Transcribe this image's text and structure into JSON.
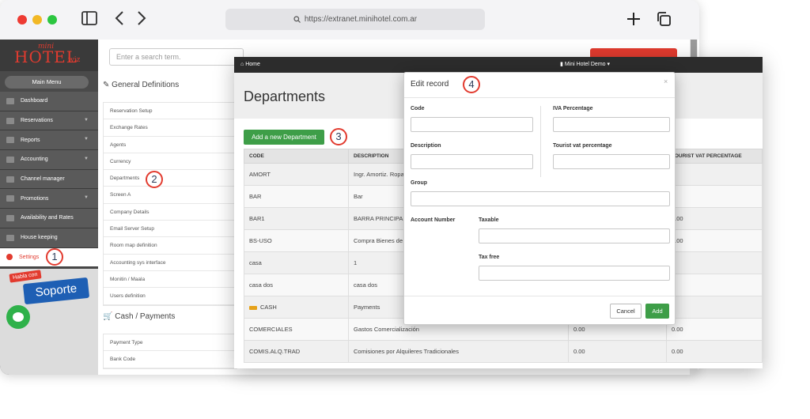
{
  "browser": {
    "url": "https://extranet.minihotel.com.ar",
    "sidebar_toggle_icon": "sidebar-icon",
    "back_icon": "chevron-left-icon",
    "forward_icon": "chevron-right-icon",
    "new_tab_icon": "plus-icon",
    "tabs_icon": "tabs-icon"
  },
  "logo": {
    "mini": "mini",
    "hotel": "HOTEL",
    "wiz": "wiz"
  },
  "sidebar": {
    "main_menu": "Main Menu",
    "items": [
      {
        "label": "Dashboard",
        "icon": "dashboard-icon",
        "has_submenu": false
      },
      {
        "label": "Reservations",
        "icon": "calendar-icon",
        "has_submenu": true
      },
      {
        "label": "Reports",
        "icon": "chart-icon",
        "has_submenu": true
      },
      {
        "label": "Accounting",
        "icon": "money-icon",
        "has_submenu": true
      },
      {
        "label": "Channel manager",
        "icon": "channel-icon",
        "has_submenu": false
      },
      {
        "label": "Promotions",
        "icon": "sitemap-icon",
        "has_submenu": true
      },
      {
        "label": "Availability and Rates",
        "icon": "pencil-icon",
        "has_submenu": false
      },
      {
        "label": "House keeping",
        "icon": "broom-icon",
        "has_submenu": false
      },
      {
        "label": "Settings",
        "icon": "gear-icon",
        "has_submenu": false,
        "active": true
      }
    ],
    "support_tag": "Habla con",
    "support_label": "Soporte",
    "chat_icon": "chat-icon"
  },
  "settings_page": {
    "search_placeholder": "Enter a search term.",
    "general_title": "General Definitions",
    "general_items": [
      "Reservation Setup",
      "Exchange Rates",
      "Agents",
      "Currency",
      "Departments",
      "Screen A",
      "Company Details",
      "Email Server Setup",
      "Room map definition",
      "Accounting sys interface",
      "Monitin / Maala",
      "Users definition"
    ],
    "cash_title": "Cash / Payments",
    "cash_items": [
      "Payment Type",
      "Bank Code"
    ]
  },
  "departments": {
    "home": "Home",
    "hotel_menu": "Mini Hotel Demo",
    "title": "Departments",
    "add_button": "Add a new Department",
    "columns": [
      "CODE",
      "DESCRIPTION",
      "",
      "TOURIST VAT PERCENTAGE"
    ],
    "rows": [
      {
        "code": "AMORT",
        "description": "Ingr. Amortiz. Ropa",
        "iva": "",
        "tourist": ""
      },
      {
        "code": "BAR",
        "description": "Bar",
        "iva": "",
        "tourist": ""
      },
      {
        "code": "BAR1",
        "description": "BARRA PRINCIPAL",
        "iva": "",
        "tourist": "0.00"
      },
      {
        "code": "BS-USO",
        "description": "Compra Bienes de",
        "iva": "",
        "tourist": "0.00"
      },
      {
        "code": "casa",
        "description": "1",
        "iva": "",
        "tourist": ""
      },
      {
        "code": "casa dos",
        "description": "casa dos",
        "iva": "",
        "tourist": ""
      },
      {
        "code": "CASH",
        "description": "Payments",
        "iva": "",
        "tourist": ""
      },
      {
        "code": "COMERCIALES",
        "description": "Gastos Comercialización",
        "iva": "0.00",
        "tourist": "0.00"
      },
      {
        "code": "COMIS.ALQ.TRAD",
        "description": "Comisiones por Alquileres Tradicionales",
        "iva": "0.00",
        "tourist": "0.00"
      }
    ]
  },
  "modal": {
    "title": "Edit record",
    "close": "×",
    "code_label": "Code",
    "iva_label": "IVA Percentage",
    "description_label": "Description",
    "tourist_label": "Tourist vat percentage",
    "group_label": "Group",
    "account_number_label": "Account Number",
    "taxable_label": "Taxable",
    "tax_free_label": "Tax free",
    "cancel": "Cancel",
    "add": "Add"
  },
  "steps": [
    "1",
    "2",
    "3",
    "4"
  ]
}
